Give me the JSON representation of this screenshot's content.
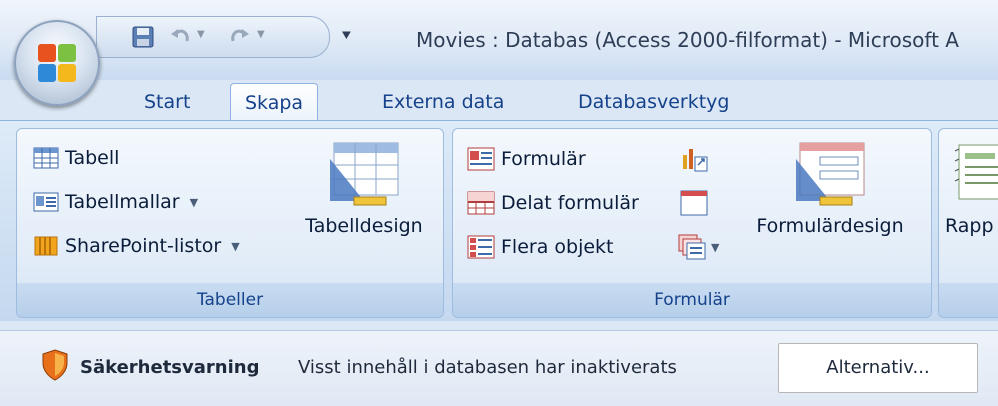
{
  "window": {
    "title": "Movies : Databas (Access 2000-filformat) - Microsoft A"
  },
  "quick_access": {
    "items": [
      "save-icon",
      "undo-icon",
      "redo-icon",
      "customize-dropdown-icon"
    ]
  },
  "ribbon": {
    "tabs": [
      {
        "label": "Start",
        "active": false
      },
      {
        "label": "Skapa",
        "active": true
      },
      {
        "label": "Externa data",
        "active": false
      },
      {
        "label": "Databasverktyg",
        "active": false
      }
    ],
    "groups": {
      "tabeller": {
        "label": "Tabeller",
        "commands": {
          "tabell": "Tabell",
          "tabellmallar": "Tabellmallar",
          "sharepoint": "SharePoint-listor",
          "tabelldesign": "Tabelldesign"
        }
      },
      "formular": {
        "label": "Formulär",
        "commands": {
          "formular": "Formulär",
          "delat": "Delat formulär",
          "flera": "Flera objekt",
          "formulardesign": "Formulärdesign"
        }
      },
      "rapport": {
        "label_partial": "Rapp"
      }
    }
  },
  "message_bar": {
    "title": "Säkerhetsvarning",
    "text": "Visst innehåll i databasen har inaktiverats",
    "button": "Alternativ..."
  },
  "colors": {
    "ribbon_text": "#15428b",
    "accent_blue": "#8db2e3",
    "warning_orange": "#e8701a"
  }
}
